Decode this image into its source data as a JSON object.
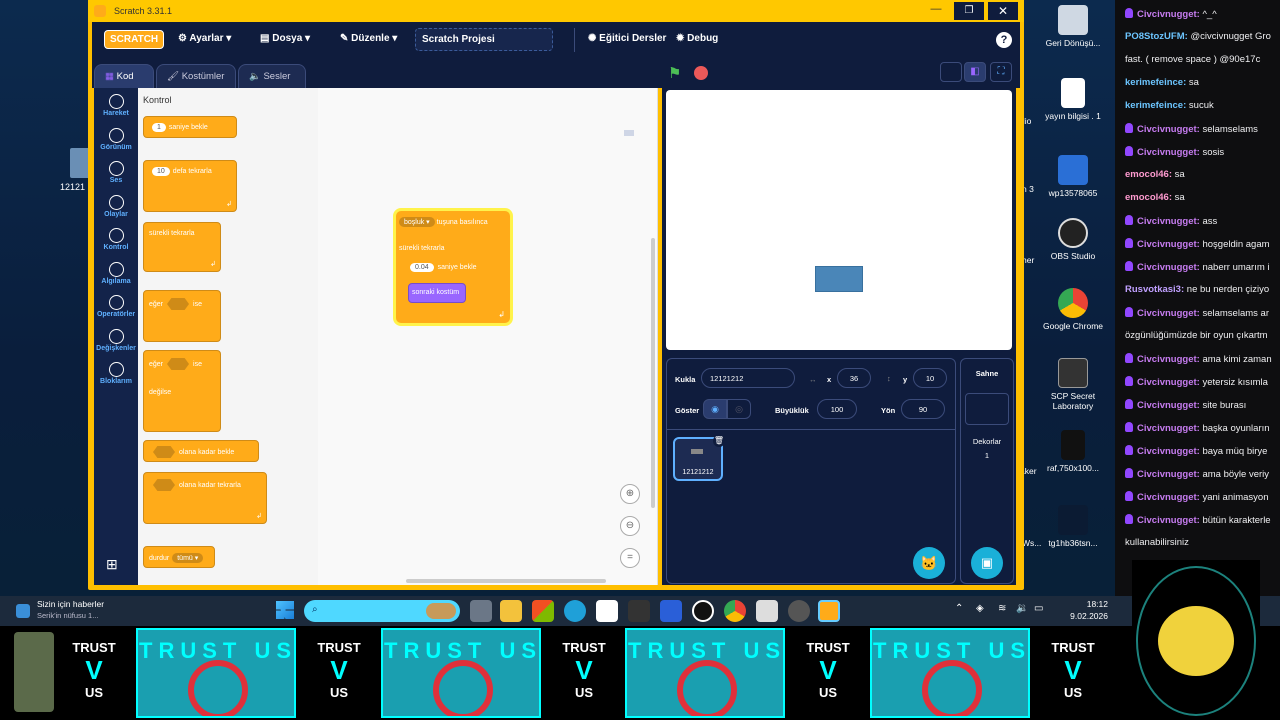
{
  "window": {
    "title": "Scratch 3.31.1"
  },
  "menu": {
    "logo": "SCRATCH",
    "settings": "Ayarlar",
    "file": "Dosya",
    "edit": "Düzenle",
    "project_title": "Scratch Projesi",
    "tutorials": "Eğitici Dersler",
    "debug": "Debug"
  },
  "tabs": {
    "code": "Kod",
    "costumes": "Kostümler",
    "sounds": "Sesler"
  },
  "categories": [
    "Hareket",
    "Görünüm",
    "Ses",
    "Olaylar",
    "Kontrol",
    "Algılama",
    "Operatörler",
    "Değişkenler",
    "Bloklarım"
  ],
  "palette": {
    "section_title": "Kontrol",
    "wait": "saniye bekle",
    "wait_value": "1",
    "repeat": "defa tekrarla",
    "repeat_value": "10",
    "forever": "sürekli tekrarla",
    "if": "eğer",
    "then": "ise",
    "if2": "eğer",
    "then2": "ise",
    "else": "değilse",
    "wait_until": "olana kadar bekle",
    "repeat_until": "olana kadar tekrarla",
    "stop": "durdur",
    "stop_value": "tümü"
  },
  "script": {
    "key": "boşluk",
    "event": "tuşuna basılınca",
    "forever": "sürekli tekrarla",
    "wait_value": "0.04",
    "wait": "saniye bekle",
    "next_costume": "sonraki kostüm"
  },
  "sprite_info": {
    "sprite_label": "Kukla",
    "sprite_name": "12121212",
    "x_label": "x",
    "x_value": "36",
    "y_label": "y",
    "y_value": "10",
    "show_label": "Göster",
    "size_label": "Büyüklük",
    "size_value": "100",
    "direction_label": "Yön",
    "direction_value": "90"
  },
  "sprite_thumb": {
    "name": "12121212"
  },
  "stage_panel": {
    "label": "Sahne",
    "backdrops_label": "Dekorlar",
    "backdrops_count": "1"
  },
  "desktop_icons": [
    {
      "label": "Geri Dönüşü..."
    },
    {
      "label": "yayın bilgisi . 1"
    },
    {
      "label": "wp13578065"
    },
    {
      "label": "OBS Studio"
    },
    {
      "label": "Google Chrome"
    },
    {
      "label": "SCP Secret Laboratory"
    },
    {
      "label": "raf,750x100..."
    },
    {
      "label": "tg1hb36tsn..."
    }
  ],
  "desktop_partial": {
    "left_label": "12121",
    "cut1": "dio",
    "cut2": "n 3",
    "cut3": "her",
    "cut4": "aker",
    "cut5": "Ws..."
  },
  "chat": [
    {
      "user": "Civcivnugget",
      "text": " ^_^"
    },
    {
      "user": "PO8StozUFM",
      "text": " @civcivnugget Gro"
    },
    {
      "user": "",
      "text": "fast. ( remove space ) @90e17c"
    },
    {
      "user": "kerimefeince",
      "text": " sa"
    },
    {
      "user": "kerimefeince",
      "text": " sucuk"
    },
    {
      "user": "Civcivnugget",
      "text": " selamselams"
    },
    {
      "user": "Civcivnugget",
      "text": " sosis"
    },
    {
      "user": "emocol46",
      "text": " sa"
    },
    {
      "user": "emocol46",
      "text": " sa"
    },
    {
      "user": "Civcivnugget",
      "text": " ass"
    },
    {
      "user": "Civcivnugget",
      "text": " hoşgeldin agam"
    },
    {
      "user": "Civcivnugget",
      "text": " naberr umarım i"
    },
    {
      "user": "Rusvotkasi3",
      "text": " ne bu nerden çiziyo"
    },
    {
      "user": "Civcivnugget",
      "text": " selamselams ar"
    },
    {
      "user": "",
      "text": "özgünlüğümüzde bir oyun çıkartm"
    },
    {
      "user": "Civcivnugget",
      "text": " ama kimi zaman"
    },
    {
      "user": "Civcivnugget",
      "text": " yetersiz kısımla"
    },
    {
      "user": "Civcivnugget",
      "text": " site burası"
    },
    {
      "user": "Civcivnugget",
      "text": " başka oyunların"
    },
    {
      "user": "Civcivnugget",
      "text": " baya müq birye"
    },
    {
      "user": "Civcivnugget",
      "text": " ama böyle veriy"
    },
    {
      "user": "Civcivnugget",
      "text": " yani animasyon"
    },
    {
      "user": "Civcivnugget",
      "text": " bütün karakterle"
    },
    {
      "user": "",
      "text": "kullanabilirsiniz"
    }
  ],
  "taskbar": {
    "news_title": "Sizin için haberler",
    "news_sub": "Serik'in nüfusu 1...",
    "time": "18:12",
    "date": "9.02.2026"
  },
  "banner": {
    "trust_top": "TRUST",
    "trust_bottom": "US",
    "panel_text": "TRUST US"
  }
}
